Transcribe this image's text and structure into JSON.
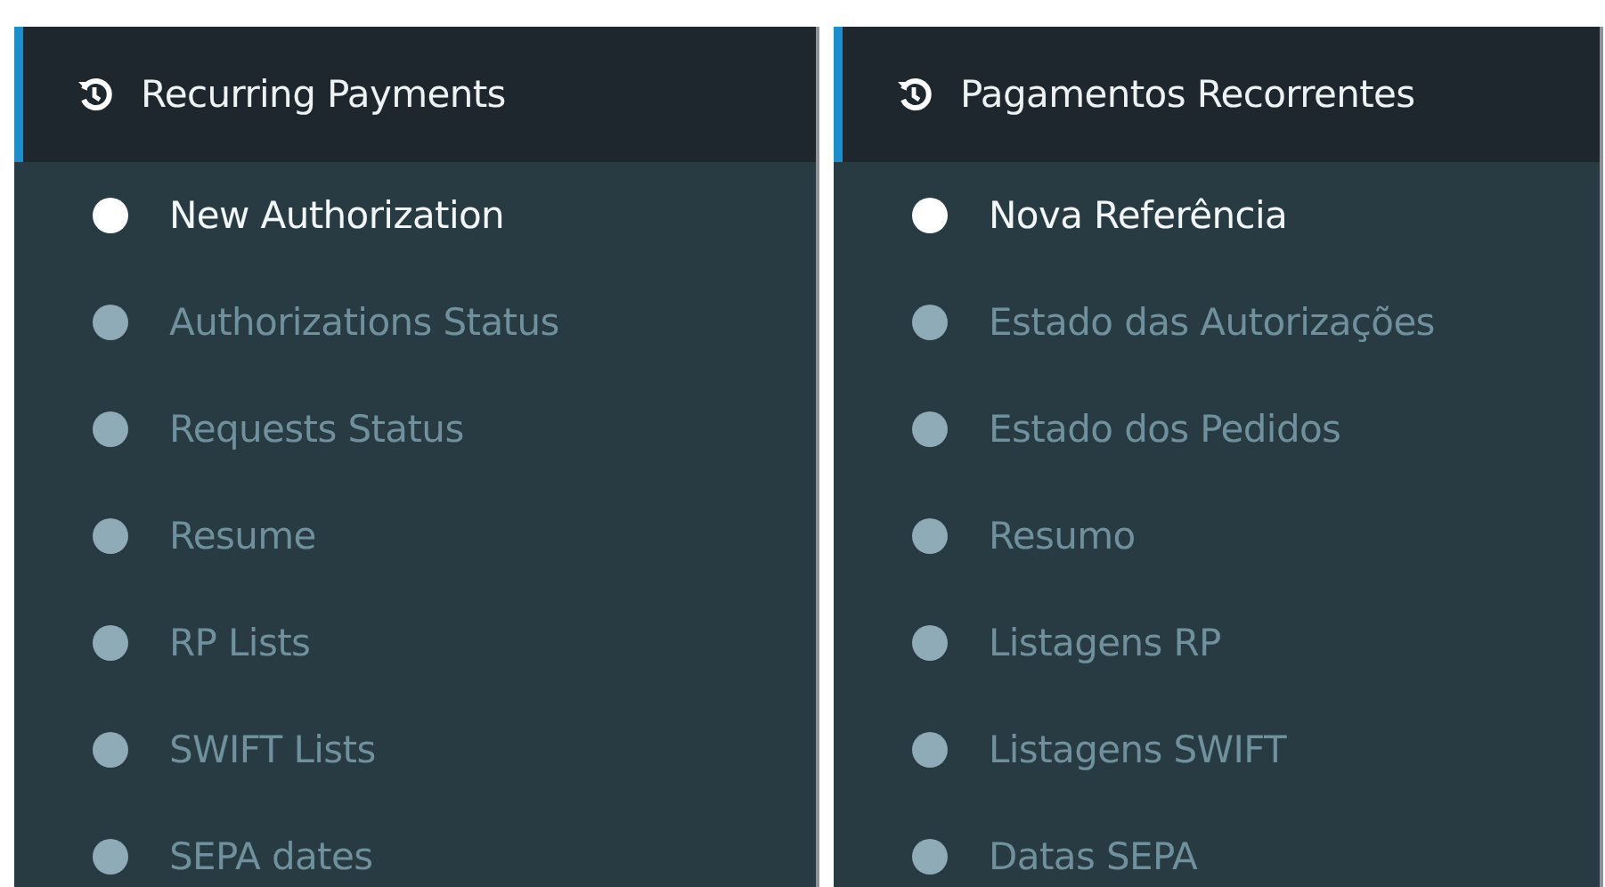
{
  "panels": [
    {
      "title": "Recurring Payments",
      "items": [
        {
          "label": "New Authorization",
          "selected": true
        },
        {
          "label": "Authorizations Status",
          "selected": false
        },
        {
          "label": "Requests Status",
          "selected": false
        },
        {
          "label": "Resume",
          "selected": false
        },
        {
          "label": "RP Lists",
          "selected": false
        },
        {
          "label": "SWIFT Lists",
          "selected": false
        },
        {
          "label": "SEPA dates",
          "selected": false
        }
      ]
    },
    {
      "title": "Pagamentos Recorrentes",
      "items": [
        {
          "label": "Nova Referência",
          "selected": true
        },
        {
          "label": "Estado das Autorizações",
          "selected": false
        },
        {
          "label": "Estado dos Pedidos",
          "selected": false
        },
        {
          "label": "Resumo",
          "selected": false
        },
        {
          "label": "Listagens RP",
          "selected": false
        },
        {
          "label": "Listagens SWIFT",
          "selected": false
        },
        {
          "label": "Datas SEPA",
          "selected": false
        }
      ]
    }
  ]
}
